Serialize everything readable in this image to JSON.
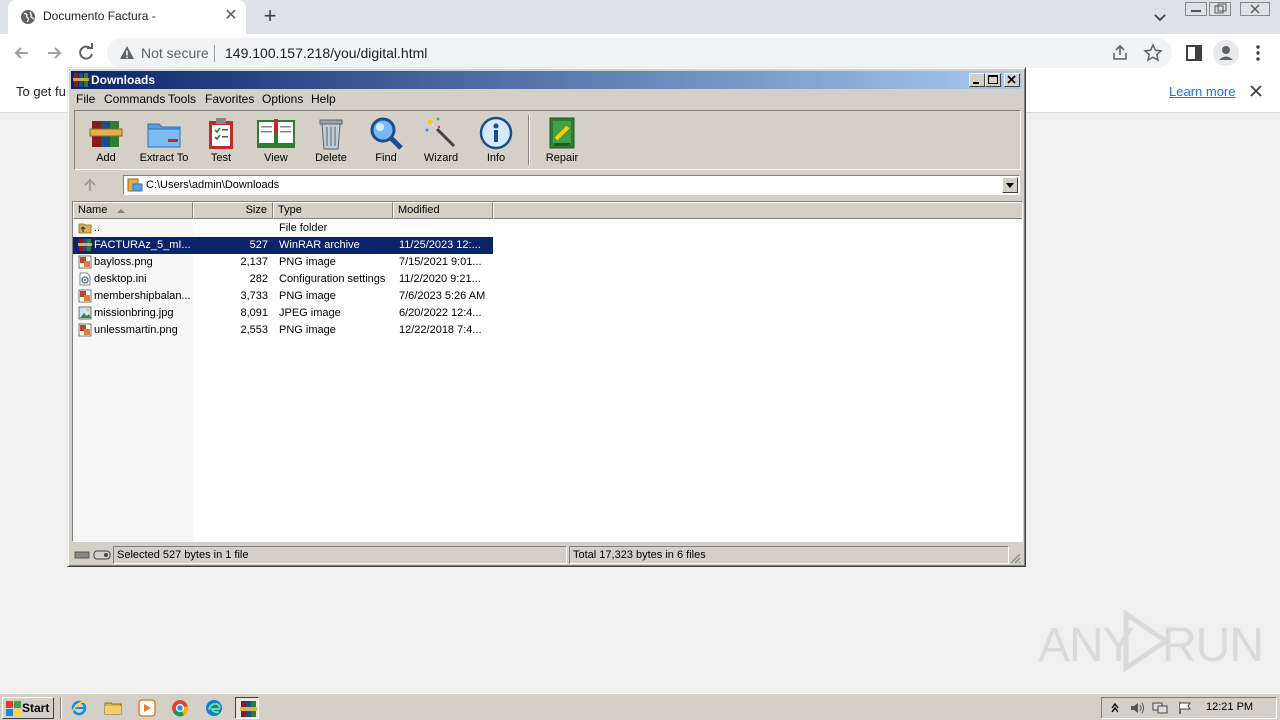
{
  "browser": {
    "tab_title": "Documento Factura -",
    "omnibox_security": "Not secure",
    "url": "149.100.157.218/you/digital.html",
    "infobar_text": "To get fu",
    "infobar_link": "Learn more"
  },
  "winrar": {
    "title": "Downloads",
    "menu": [
      "File",
      "Commands",
      "Tools",
      "Favorites",
      "Options",
      "Help"
    ],
    "toolbar": [
      {
        "label": "Add",
        "icon": "add-archive-icon"
      },
      {
        "label": "Extract To",
        "icon": "extract-folder-icon"
      },
      {
        "label": "Test",
        "icon": "test-clipboard-icon"
      },
      {
        "label": "View",
        "icon": "view-book-icon"
      },
      {
        "label": "Delete",
        "icon": "trash-can-icon"
      },
      {
        "label": "Find",
        "icon": "magnifier-icon"
      },
      {
        "label": "Wizard",
        "icon": "magic-wand-icon"
      },
      {
        "label": "Info",
        "icon": "info-icon"
      },
      {
        "label": "Repair",
        "icon": "repair-kit-icon"
      }
    ],
    "path": "C:\\Users\\admin\\Downloads",
    "columns": [
      "Name",
      "Size",
      "Type",
      "Modified"
    ],
    "files": [
      {
        "name": "..",
        "size": "",
        "type": "File folder",
        "modified": "",
        "icon": "parent-folder-icon"
      },
      {
        "name": "FACTURAz_5_mI...",
        "size": "527",
        "type": "WinRAR archive",
        "modified": "11/25/2023 12:...",
        "icon": "rar-archive-icon",
        "selected": true
      },
      {
        "name": "bayloss.png",
        "size": "2,137",
        "type": "PNG image",
        "modified": "7/15/2021 9:01...",
        "icon": "png-image-icon"
      },
      {
        "name": "desktop.ini",
        "size": "282",
        "type": "Configuration settings",
        "modified": "11/2/2020 9:21...",
        "icon": "ini-settings-icon"
      },
      {
        "name": "membershipbalan...",
        "size": "3,733",
        "type": "PNG image",
        "modified": "7/6/2023 5:26 AM",
        "icon": "png-image-icon"
      },
      {
        "name": "missionbring.jpg",
        "size": "8,091",
        "type": "JPEG image",
        "modified": "6/20/2022 12:4...",
        "icon": "jpeg-image-icon"
      },
      {
        "name": "unlessmartin.png",
        "size": "2,553",
        "type": "PNG image",
        "modified": "12/22/2018 7:4...",
        "icon": "png-image-icon"
      }
    ],
    "status_left": "Selected 527 bytes in 1 file",
    "status_right": "Total 17,323 bytes in 6 files"
  },
  "watermark": {
    "left": "ANY",
    "right": "RUN"
  },
  "taskbar": {
    "start_label": "Start",
    "pinned": [
      "internet-explorer-icon",
      "file-explorer-icon",
      "media-player-icon",
      "chrome-icon",
      "edge-icon",
      "winrar-icon"
    ],
    "clock": "12:21 PM"
  },
  "colors": {
    "title_bar_start": "#0a246a",
    "selection": "#0a246a",
    "link": "#1a73e8",
    "win_face": "#d4d0c8"
  }
}
